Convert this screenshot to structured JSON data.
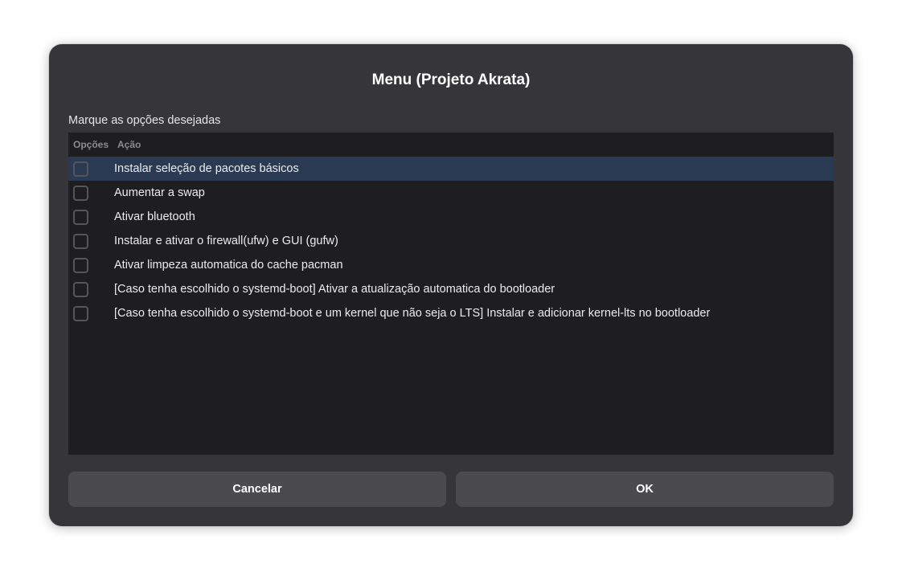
{
  "dialog": {
    "title": "Menu (Projeto Akrata)",
    "subtitle": "Marque as opções desejadas"
  },
  "list": {
    "columns": {
      "options": "Opções",
      "action": "Ação"
    },
    "selected_row": 0,
    "rows": [
      {
        "label": "Instalar seleção de pacotes básicos",
        "checked": false
      },
      {
        "label": "Aumentar a swap",
        "checked": false
      },
      {
        "label": "Ativar bluetooth",
        "checked": false
      },
      {
        "label": "Instalar e ativar o firewall(ufw) e GUI (gufw)",
        "checked": false
      },
      {
        "label": "Ativar limpeza automatica do cache pacman",
        "checked": false
      },
      {
        "label": "[Caso tenha escolhido o systemd-boot] Ativar a atualização automatica do bootloader",
        "checked": false
      },
      {
        "label": "[Caso tenha escolhido o systemd-boot e um kernel que não seja o LTS] Instalar e adicionar kernel-lts no bootloader",
        "checked": false
      }
    ]
  },
  "buttons": {
    "cancel": "Cancelar",
    "ok": "OK"
  },
  "colors": {
    "dialog_bg": "#36363a",
    "list_bg": "#1e1e20",
    "selected_row": "#2a3a52",
    "button_bg": "#4a4a4f"
  }
}
